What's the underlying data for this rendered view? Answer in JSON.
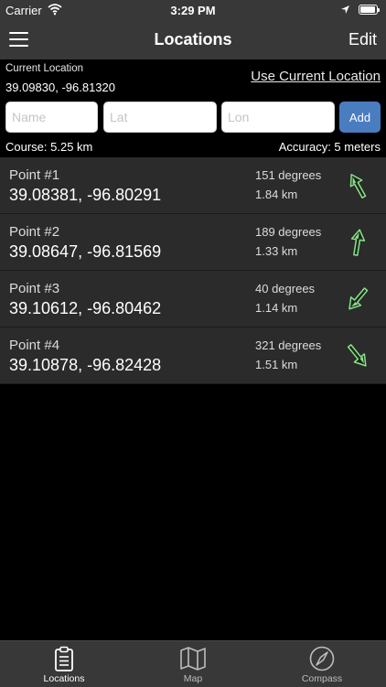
{
  "status_bar": {
    "carrier": "Carrier",
    "time": "3:29 PM",
    "battery_level": 0.95
  },
  "nav": {
    "title": "Locations",
    "edit_label": "Edit",
    "menu_icon": "hamburger-menu-icon"
  },
  "current_location": {
    "label": "Current Location",
    "value": "39.09830, -96.81320",
    "use_button_label": "Use Current Location"
  },
  "form": {
    "name_placeholder": "Name",
    "lat_placeholder": "Lat",
    "lon_placeholder": "Lon",
    "add_label": "Add",
    "add_color": "#4a7cc0"
  },
  "summary": {
    "course": "Course: 5.25 km",
    "accuracy": "Accuracy: 5 meters"
  },
  "points": [
    {
      "name": "Point #1",
      "coords": "39.08381, -96.80291",
      "bearing": "151 degrees",
      "bearing_value": 151,
      "distance": "1.84 km"
    },
    {
      "name": "Point #2",
      "coords": "39.08647, -96.81569",
      "bearing": "189 degrees",
      "bearing_value": 189,
      "distance": "1.33 km"
    },
    {
      "name": "Point #3",
      "coords": "39.10612, -96.80462",
      "bearing": "40 degrees",
      "bearing_value": 40,
      "distance": "1.14 km"
    },
    {
      "name": "Point #4",
      "coords": "39.10878, -96.82428",
      "bearing": "321 degrees",
      "bearing_value": 321,
      "distance": "1.51 km"
    }
  ],
  "arrow_color": "#8be08b",
  "tabs": [
    {
      "label": "Locations",
      "icon": "clipboard-icon",
      "active": true
    },
    {
      "label": "Map",
      "icon": "map-icon",
      "active": false
    },
    {
      "label": "Compass",
      "icon": "compass-icon",
      "active": false
    }
  ]
}
